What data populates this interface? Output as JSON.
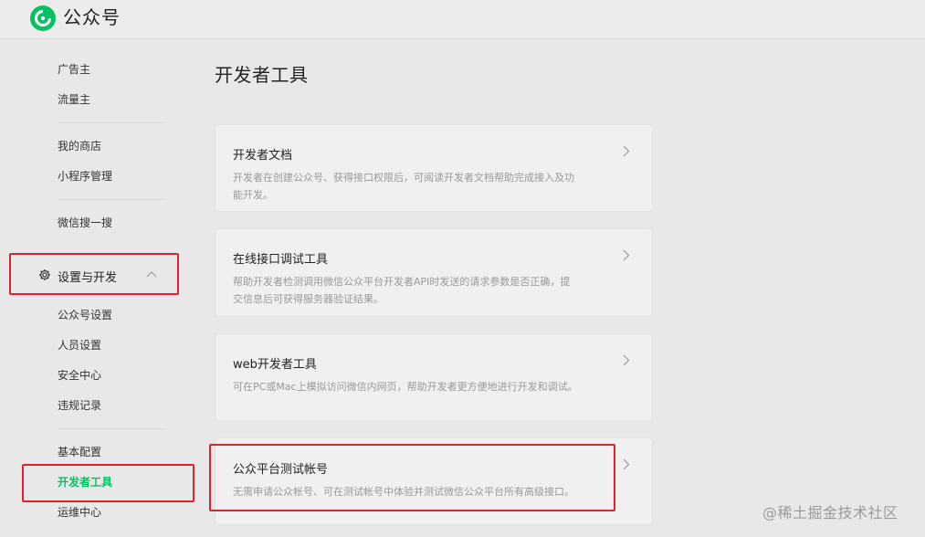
{
  "header": {
    "brand": "公众号",
    "logo_icon": "wechat-official-account-logo-icon"
  },
  "sidebar": {
    "group1": [
      "广告主",
      "流量主"
    ],
    "group2": [
      "我的商店",
      "小程序管理"
    ],
    "group3": [
      "微信搜一搜"
    ],
    "section": {
      "label": "设置与开发",
      "icon": "gear-icon",
      "expanded": true
    },
    "group4": [
      "公众号设置",
      "人员设置",
      "安全中心",
      "违规记录"
    ],
    "group5": [
      "基本配置",
      "开发者工具",
      "运维中心"
    ],
    "active_item": "开发者工具"
  },
  "main": {
    "title": "开发者工具",
    "cards": [
      {
        "title": "开发者文档",
        "desc_line1": "开发者在创建公众号、获得接口权限后，可阅读开发者文档帮助完成接入及功",
        "desc_line2": "能开发。"
      },
      {
        "title": "在线接口调试工具",
        "desc_line1": "帮助开发者检测调用微信公众平台开发者API时发送的请求参数是否正确，提",
        "desc_line2": "交信息后可获得服务器验证结果。"
      },
      {
        "title": "web开发者工具",
        "desc_line1": "可在PC或Mac上模拟访问微信内网页，帮助开发者更方便地进行开发和调试。"
      },
      {
        "title": "公众平台测试帐号",
        "desc_line1": "无需申请公众帐号、可在测试帐号中体验并测试微信公众平台所有高级接口。"
      }
    ]
  },
  "watermark": "@稀土掘金技术社区",
  "colors": {
    "accent": "#07c160",
    "highlight": "#e0222e",
    "background": "#e8e8e8"
  }
}
